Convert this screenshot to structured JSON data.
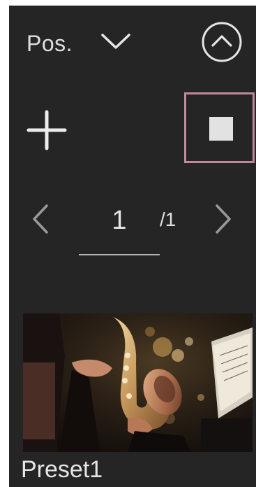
{
  "header": {
    "label": "Pos.",
    "dropdown_icon": "chevron-down-icon",
    "collapse_icon": "circle-chevron-up-icon"
  },
  "actions": {
    "add_icon": "plus-icon",
    "stop_icon": "stop-square-icon",
    "stop_highlight_color": "#c4869e"
  },
  "pagination": {
    "prev_icon": "chevron-left-icon",
    "current_page": "1",
    "total": "/1",
    "next_icon": "chevron-right-icon"
  },
  "presets": [
    {
      "name": "Preset1",
      "thumbnail": "saxophone-player-photo"
    }
  ]
}
